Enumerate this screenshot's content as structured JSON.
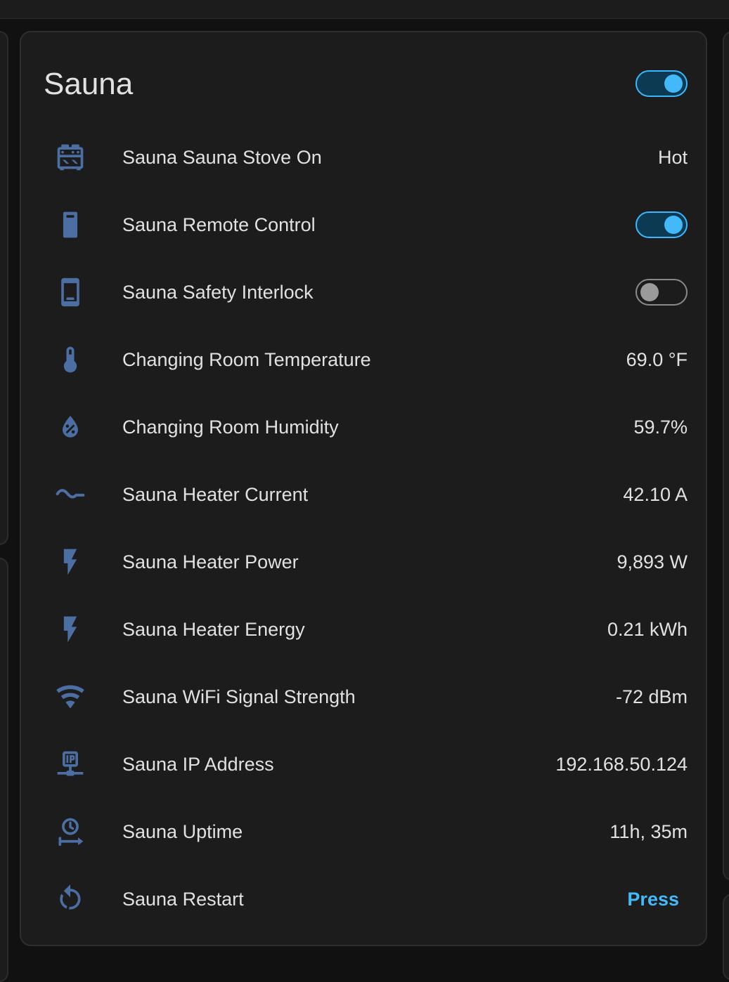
{
  "card": {
    "title": "Sauna",
    "header_toggle_on": true
  },
  "colors": {
    "icon": "#4b6fa3",
    "accent": "#44b9f9",
    "text": "#e1e1e1",
    "card_bg": "#1c1c1c"
  },
  "rows": [
    {
      "label": "Sauna Sauna Stove On",
      "value": "Hot",
      "icon": "stove-icon"
    },
    {
      "label": "Sauna Remote Control",
      "toggle_on": true,
      "icon": "remote-icon"
    },
    {
      "label": "Sauna Safety Interlock",
      "toggle_on": false,
      "icon": "cellphone-icon"
    },
    {
      "label": "Changing Room Temperature",
      "value": "69.0 °F",
      "icon": "thermometer-icon"
    },
    {
      "label": "Changing Room Humidity",
      "value": "59.7%",
      "icon": "water-percent-icon"
    },
    {
      "label": "Sauna Heater Current",
      "value": "42.10 A",
      "icon": "current-ac-icon"
    },
    {
      "label": "Sauna Heater Power",
      "value": "9,893 W",
      "icon": "flash-icon"
    },
    {
      "label": "Sauna Heater Energy",
      "value": "0.21 kWh",
      "icon": "flash-icon"
    },
    {
      "label": "Sauna WiFi Signal Strength",
      "value": "-72 dBm",
      "icon": "wifi-icon"
    },
    {
      "label": "Sauna IP Address",
      "value": "192.168.50.124",
      "icon": "ip-network-icon"
    },
    {
      "label": "Sauna Uptime",
      "value": "11h, 35m",
      "icon": "clock-arrow-icon"
    },
    {
      "label": "Sauna Restart",
      "button": "Press",
      "icon": "restart-icon"
    }
  ]
}
